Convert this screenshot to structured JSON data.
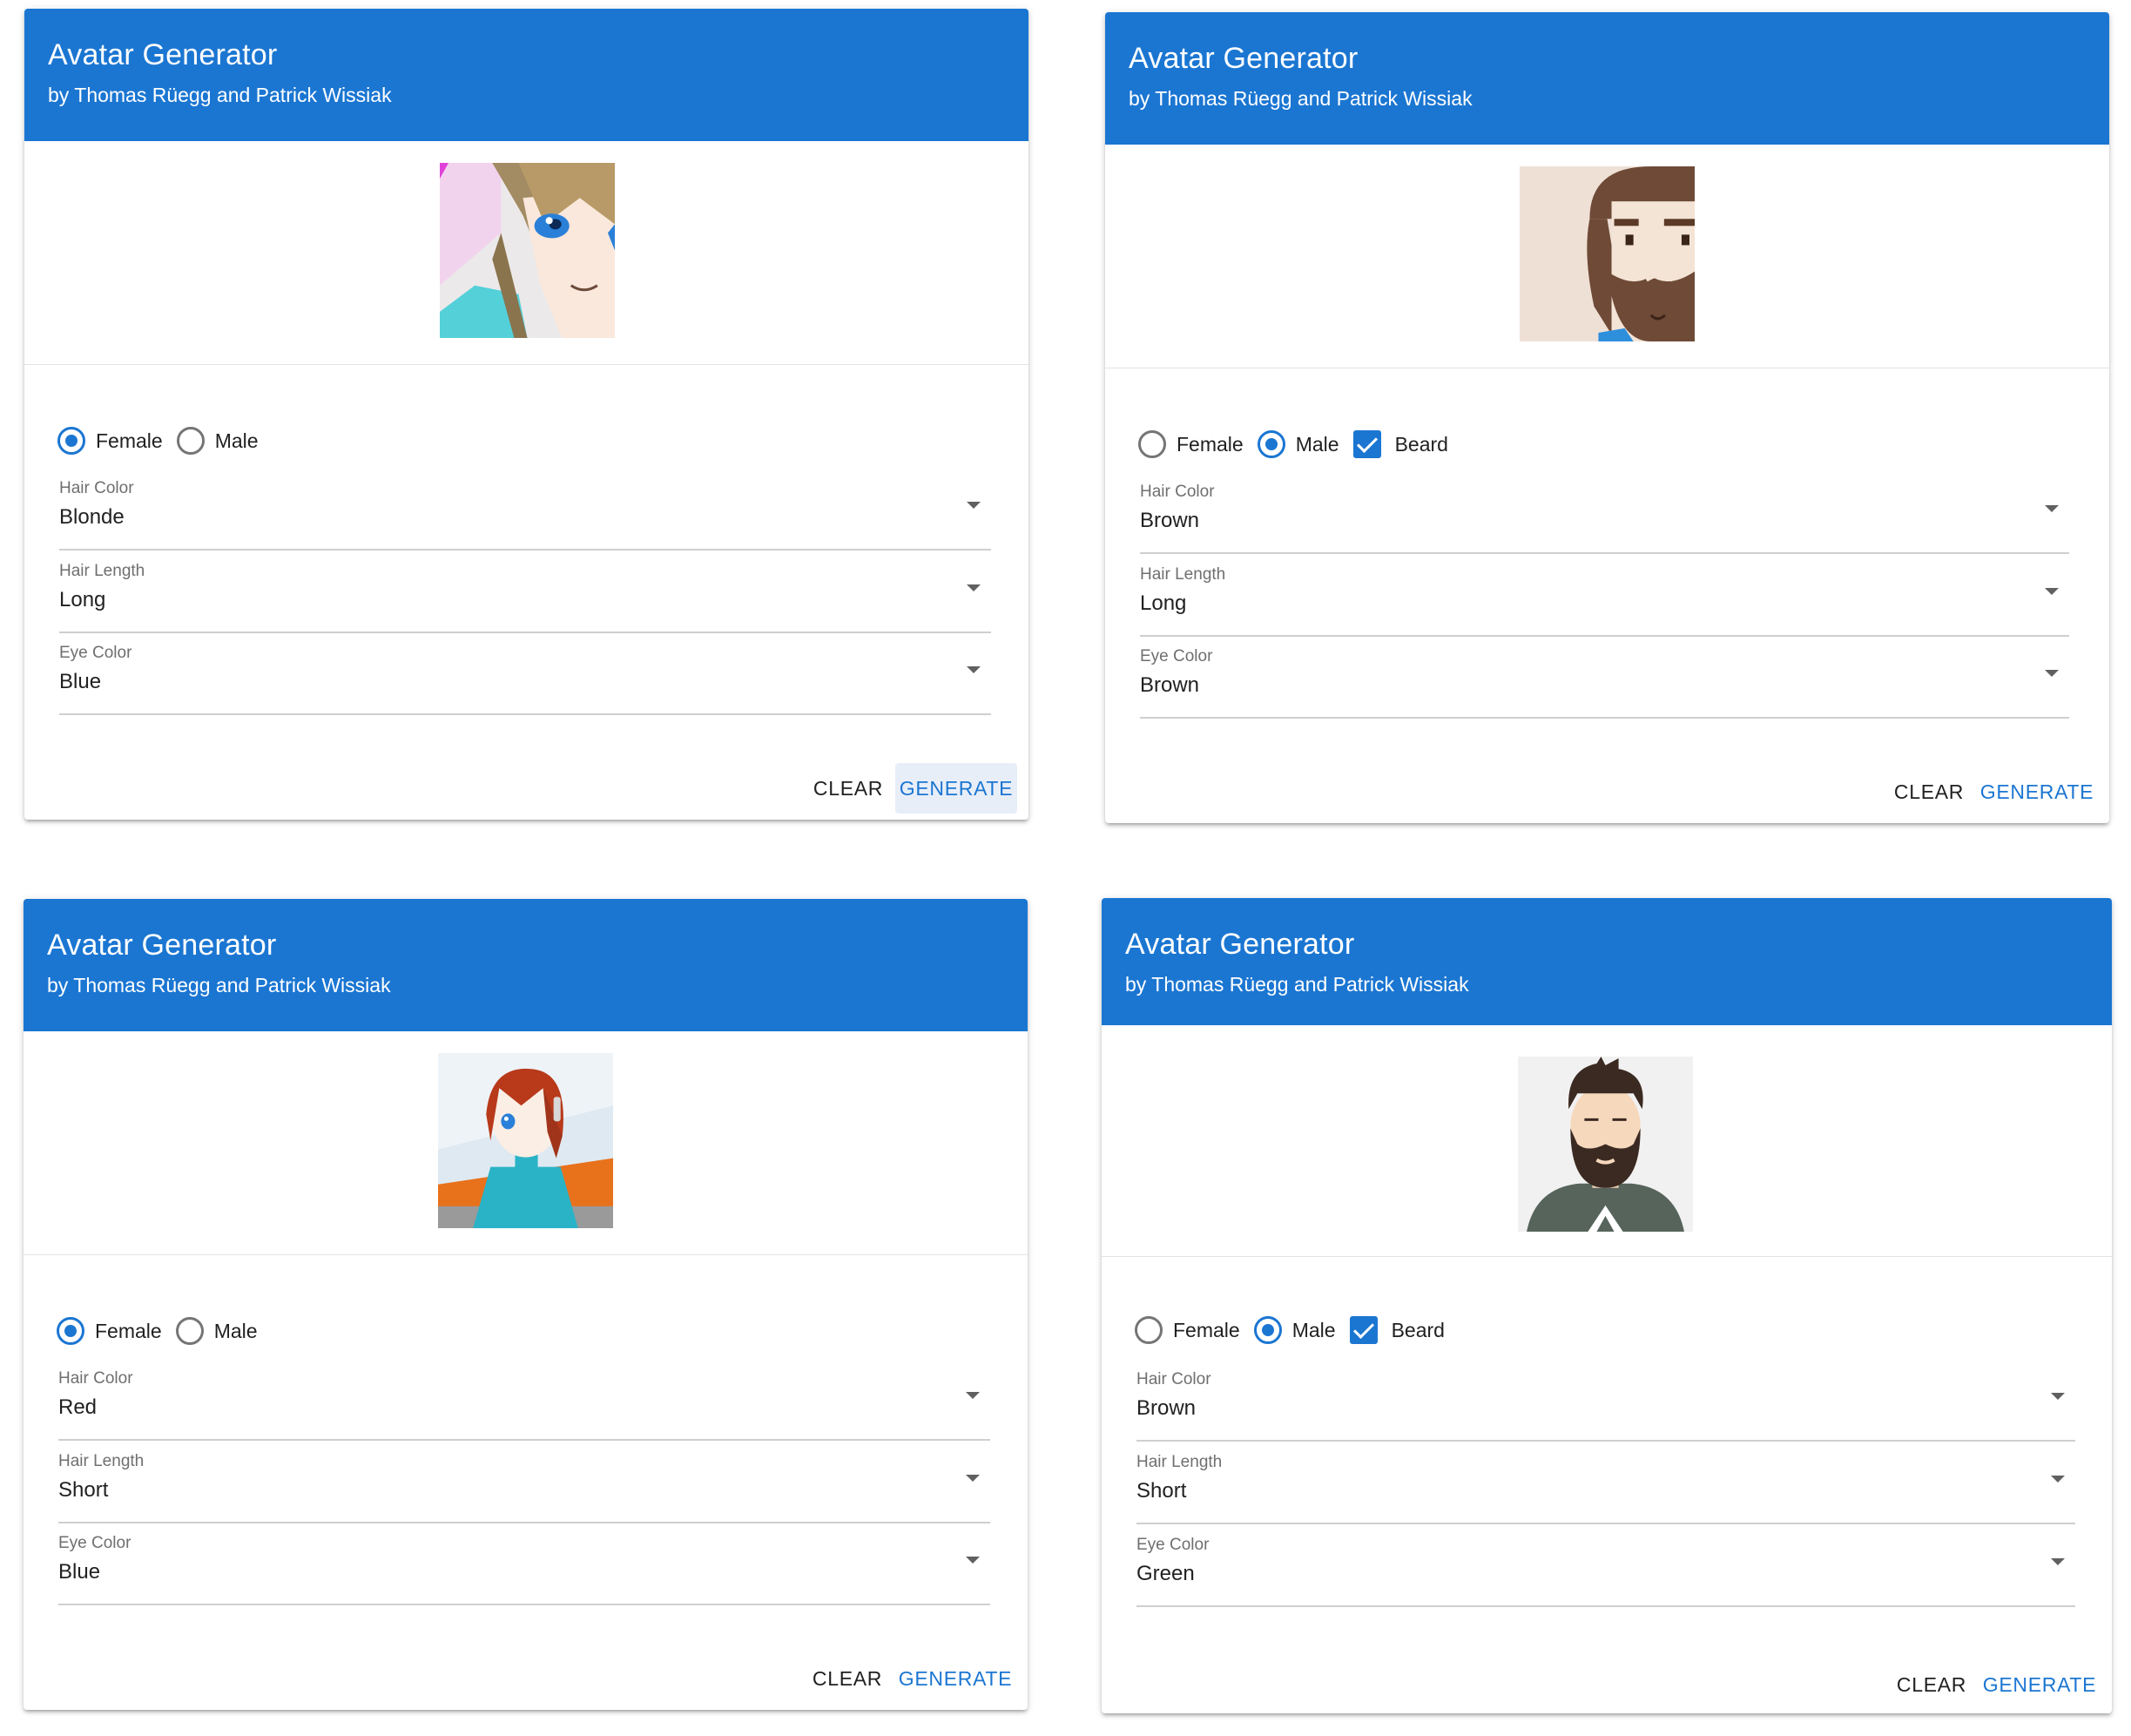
{
  "app": {
    "title": "Avatar Generator",
    "subtitle": "by Thomas Rüegg and Patrick Wissiak",
    "accent_color": "#1b76d2"
  },
  "cards": [
    {
      "gender_options": [
        "Female",
        "Male"
      ],
      "selected_gender": "Female",
      "fields": [
        {
          "label": "Hair Color",
          "value": "Blonde"
        },
        {
          "label": "Hair Length",
          "value": "Long"
        },
        {
          "label": "Eye Color",
          "value": "Blue"
        }
      ],
      "buttons": {
        "clear": "CLEAR",
        "generate": "GENERATE"
      },
      "avatar": "anime-female-blonde-long-hair"
    },
    {
      "gender_options": [
        "Female",
        "Male"
      ],
      "selected_gender": "Male",
      "beard": {
        "label": "Beard",
        "checked": true
      },
      "fields": [
        {
          "label": "Hair Color",
          "value": "Brown"
        },
        {
          "label": "Hair Length",
          "value": "Long"
        },
        {
          "label": "Eye Color",
          "value": "Brown"
        }
      ],
      "buttons": {
        "clear": "CLEAR",
        "generate": "GENERATE"
      },
      "avatar": "flat-male-brown-long-hair-beard"
    },
    {
      "gender_options": [
        "Female",
        "Male"
      ],
      "selected_gender": "Female",
      "fields": [
        {
          "label": "Hair Color",
          "value": "Red"
        },
        {
          "label": "Hair Length",
          "value": "Short"
        },
        {
          "label": "Eye Color",
          "value": "Blue"
        }
      ],
      "buttons": {
        "clear": "CLEAR",
        "generate": "GENERATE"
      },
      "avatar": "anime-female-red-short-hair"
    },
    {
      "gender_options": [
        "Female",
        "Male"
      ],
      "selected_gender": "Male",
      "beard": {
        "label": "Beard",
        "checked": true
      },
      "fields": [
        {
          "label": "Hair Color",
          "value": "Brown"
        },
        {
          "label": "Hair Length",
          "value": "Short"
        },
        {
          "label": "Eye Color",
          "value": "Green"
        }
      ],
      "buttons": {
        "clear": "CLEAR",
        "generate": "GENERATE"
      },
      "avatar": "flat-male-brown-short-hair-beard"
    }
  ]
}
